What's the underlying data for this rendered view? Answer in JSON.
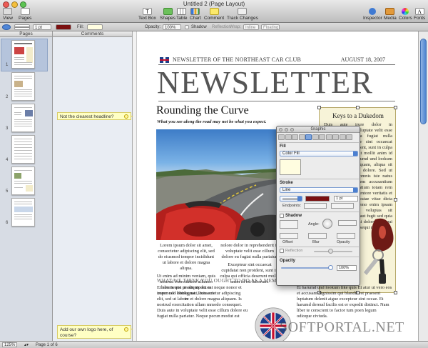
{
  "window": {
    "title": "Untitled 2 (Page Layout)"
  },
  "toolbar": {
    "view": "View",
    "pages": "Pages",
    "text_box": "Text Box",
    "shapes": "Shapes",
    "table": "Table",
    "chart": "Chart",
    "comment": "Comment",
    "track_changes": "Track Changes",
    "inspector": "Inspector",
    "media": "Media",
    "colors": "Colors",
    "fonts": "Fonts"
  },
  "formatbar": {
    "stroke_width": "1 pt",
    "fill_label": "Fill:",
    "opacity_label": "Opacity:",
    "opacity_value": "100%",
    "shadow": "Shadow",
    "reflection": "Reflection",
    "inline": "Inline",
    "floating": "Floating",
    "wrap_label": "Wrap:"
  },
  "columns": {
    "pages": "Pages",
    "comments": "Comments"
  },
  "thumbnails": [
    "1",
    "2",
    "3",
    "4",
    "5",
    "6"
  ],
  "comments": [
    {
      "text": "Not the clearest headline?"
    },
    {
      "text": "Add our own logo here, of course?"
    }
  ],
  "newsletter": {
    "club": "NEWSLETTER OF THE NORTHEAST CAR CLUB",
    "date": "AUGUST 18, 2007",
    "title": "NEWSLETTER",
    "headline": "Rounding the Curve",
    "subhead": "What you see along the road may not be what you expect.",
    "col1_p1": "Lorem ipsum dolor sit amet, consectetur adipiscing elit, sed do eiusmod tempor incididunt ut labore et dolore magna aliqua.",
    "col1_p2": "Ut enim ad minim veniam, quis nostrud exercitation ullamco laboris nisi ut aliquip ex ea commodo consequat. Duis aute in",
    "col2_p1": "nolore dolor in reprehenderit in voluptate velit esse cillum dolore eu fugiat nulla pariatur.",
    "col2_p2": "Excepteur sint occaecat cupidatat non proident, sunt in culpa qui officia deserunt mollit anim id est laborum.",
    "sidebar_title": "Keys to a Dukedom",
    "sidebar_text": "Duis aute irure dolor in reprehenderit in voluptate velit esse cillum dolore eu fugiat nulla pariatur. Excepteur sint occaecat cupidatat non proident, sunt in culpa qui officia deserunt mollit anim id est laborum. Et harumd und lookum libero est ex quisquam, aliqua sit amet ut labore et dolore. Sed ut perspiciatis unde omnis iste natus error sit voluptatem accusantium doloremque laudantium totam rem aperiam ab illo inventore veritatis et quasi architecto beatae vitae dicta sunt explicabo. Nemo enim ipsam voluptatem quia voluptas sit aspernatur aut odit aut fugit sed quia consequuntur magni dolores eos qui ratione voluptatem sequi nesciunt.",
    "bottom_head": "WHAT WE THINK YOU OUGHT TO DO AS A MEMBER OF OUR CLUB",
    "bottom_col1": "Et tam neque pecun modut est neque nonor et imper ned libidig met, consectetur adipiscing elit, sed ut labore et dolore magna aliquam. Is nostrud exercitation ullam mmodo consequet. Duis aute in voluptate velit esse cillum dolore eu fugiat nulla pariatur. Neque pecun modut est",
    "bottom_col2": "Et harumd und lookum like quis Et atur ut vero eos et accusam dignissim qui blandit est praesent luptatum delenit aigue excepteur sint occae. Et harumd dereud facilis est er expedit distinct. Nam liber te conscient to factor tum poen legum odioque civiuda."
  },
  "inspector": {
    "title": "Graphic",
    "fill_section": "Fill",
    "fill_type": "Color Fill",
    "stroke_section": "Stroke",
    "stroke_type": "Line",
    "stroke_width": "1 pt",
    "endpoints": "Endpoints:",
    "shadow": "Shadow",
    "angle": "Angle:",
    "offset": "Offset",
    "blur": "Blur",
    "opacity_label": "Opacity",
    "reflection": "Reflection",
    "opacity_section": "Opacity",
    "opacity_value": "100%"
  },
  "status": {
    "zoom": "125%",
    "page": "Page 1 of 6"
  },
  "watermark": "SOFTPORTAL.NET",
  "colors": {
    "stroke_color": "#7a1010",
    "fill_color": "#fffde0",
    "accent": "#4b7fd1"
  }
}
